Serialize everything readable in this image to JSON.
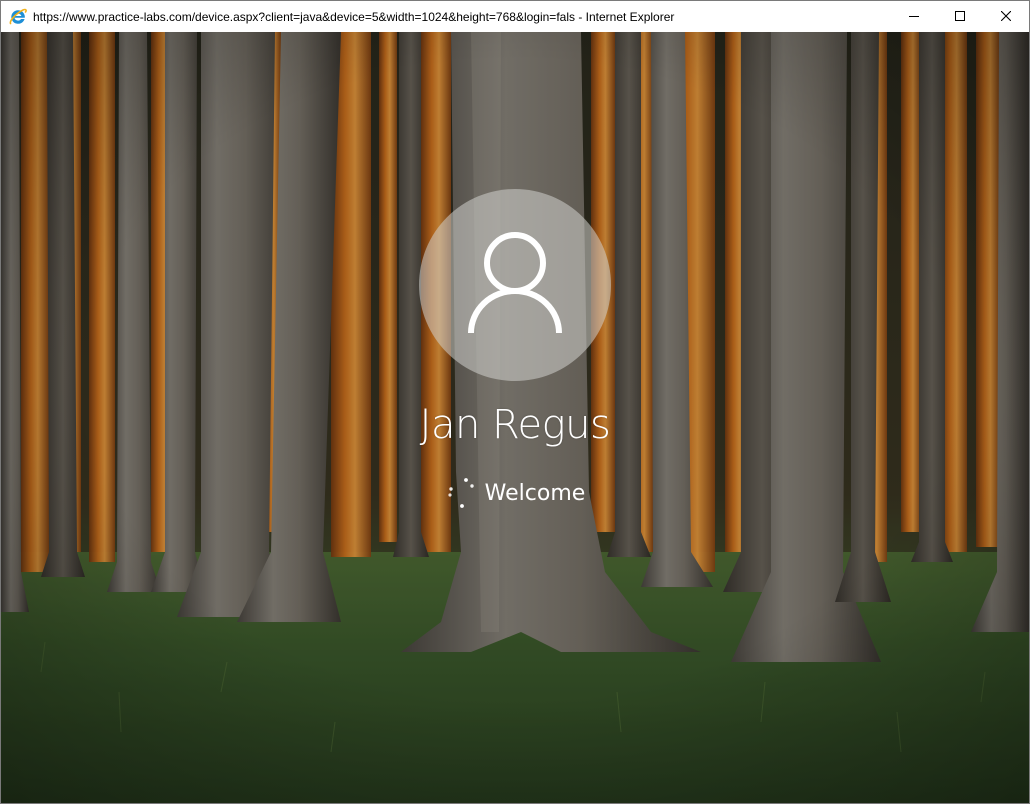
{
  "window": {
    "title": "https://www.practice-labs.com/device.aspx?client=java&device=5&width=1024&height=768&login=fals - Internet Explorer",
    "app_icon": "internet-explorer-icon",
    "controls": {
      "minimize_icon": "minimize-icon",
      "maximize_icon": "maximize-icon",
      "close_icon": "close-icon"
    }
  },
  "lock_screen": {
    "background": "forest-of-beech-trees-with-orange-light",
    "avatar_icon": "user-avatar-icon",
    "user_name": "Jan Regus",
    "status_text": "Welcome",
    "spinner_icon": "loading-spinner-icon"
  },
  "colors": {
    "titlebar_bg": "#ffffff",
    "text_light": "#ffffff",
    "avatar_bg": "#c8c8c2"
  }
}
